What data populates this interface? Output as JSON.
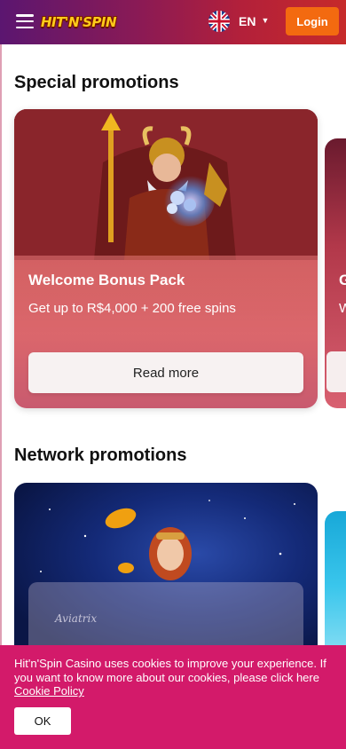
{
  "header": {
    "logo_text": "HIT'N'SPIN",
    "language": "EN",
    "login_label": "Login",
    "colors": {
      "gradient_start": "#5b1670",
      "gradient_end": "#c62a2a",
      "login_bg": "#f36a10"
    }
  },
  "special": {
    "title": "Special promotions",
    "card": {
      "title": "Welcome Bonus Pack",
      "subtitle": "Get up to R$4,000 + 200 free spins",
      "button_label": "Read more"
    },
    "peek": {
      "letter": "G",
      "sub": "W"
    }
  },
  "network": {
    "title": "Network promotions",
    "card": {
      "brand": "Aviatrix"
    }
  },
  "cookie": {
    "text": "Hit'n'Spin Casino uses cookies to improve your experience. If you want to know more about our cookies, please click here",
    "link_label": "Cookie Policy",
    "ok_label": "OK",
    "background": "#d31a6a"
  }
}
